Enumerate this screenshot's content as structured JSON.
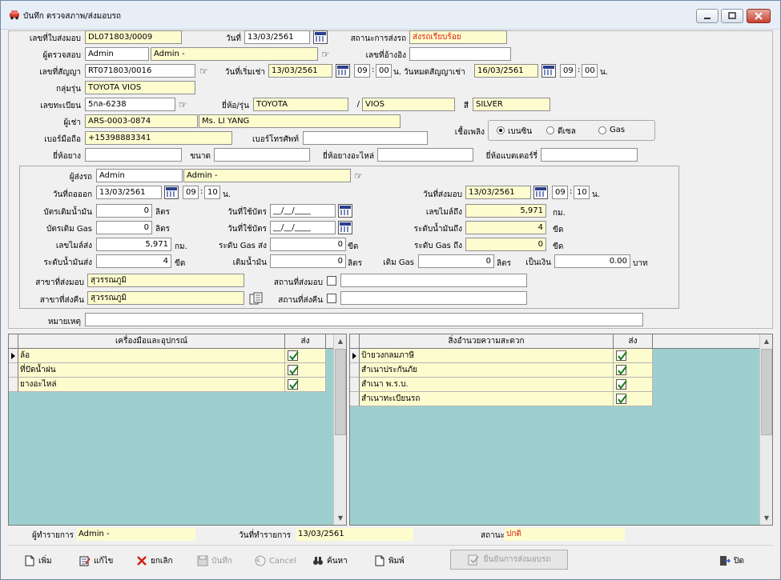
{
  "window": {
    "title": "บันทึก ตรวจสภาพ/ส่งมอบรถ"
  },
  "header": {
    "doc_no_label": "เลขที่ใบส่งมอบ",
    "doc_no": "DL071803/0009",
    "date_label": "วันที่",
    "date": "13/03/2561",
    "car_status_label": "สถานะการส่งรถ",
    "car_status": "ส่งรถเรียบร้อย",
    "inspector_label": "ผู้ตรวจสอบ",
    "inspector_code": "Admin",
    "inspector_name": "Admin -",
    "ref_no_label": "เลขที่อ้างอิง",
    "ref_no": "",
    "contract_label": "เลขที่สัญญา",
    "contract_no": "RT071803/0016",
    "rent_start_label": "วันที่เริ่มเช่า",
    "rent_start": "13/03/2561",
    "rent_start_h": "09",
    "rent_start_m": "00",
    "n1": "น.",
    "rent_end_label": "วันหมดสัญญาเช่า",
    "rent_end": "16/03/2561",
    "rent_end_h": "09",
    "rent_end_m": "00",
    "n2": "น.",
    "model_group_label": "กลุ่มรุ่น",
    "model_group": "TOYOTA VIOS",
    "plate_label": "เลขทะเบียน",
    "plate": "5กล-6238",
    "brand_label": "ยี่ห้อ/รุ่น",
    "brand": "TOYOTA",
    "slash": "/",
    "model": "VIOS",
    "color_label": "สี",
    "color": "SILVER",
    "renter_label": "ผู้เช่า",
    "renter_code": "ARS-0003-0874",
    "renter_name": "Ms. LI YANG",
    "mobile_label": "เบอร์มือถือ",
    "mobile": "+15398883341",
    "phone_label": "เบอร์โทรศัพท์",
    "phone": "",
    "fuel_label": "เชื้อเพลิง",
    "fuel_options": [
      "เบนซิน",
      "ดีเซล",
      "Gas"
    ],
    "tire_brand_label": "ยี่ห้อยาง",
    "tire_brand": "",
    "size_label": "ขนาด",
    "size": "",
    "spare_tire_label": "ยี่ห้อยางอะไหล่",
    "spare_tire": "",
    "battery_label": "ยี่ห้อแบตเตอร์รี่",
    "battery": ""
  },
  "delivery": {
    "driver_label": "ผู้ส่งรถ",
    "driver_code": "Admin",
    "driver_name": "Admin -",
    "out_date_label": "วันที่ถอออก",
    "out_date": "13/03/2561",
    "out_h": "09",
    "out_m": "10",
    "n3": "น.",
    "deliver_date_label": "วันที่ส่งมอบ",
    "deliver_date": "13/03/2561",
    "deliver_h": "09",
    "deliver_m": "10",
    "n4": "น.",
    "fuel_card_label": "บัตรเติมน้ำมัน",
    "fuel_card": "0",
    "liter1": "ลิตร",
    "card_date1_label": "วันที่ใช้บัตร",
    "card_date1": "__/__/____",
    "mile_to_label": "เลขไมล์ถึง",
    "mile_to": "5,971",
    "km1": "กม.",
    "gas_card_label": "บัตรเติม Gas",
    "gas_card": "0",
    "liter2": "ลิตร",
    "card_date2_label": "วันที่ใช้บัตร",
    "card_date2": "__/__/____",
    "fuel_level_to_label": "ระดับน้ำมันถึง",
    "fuel_level_to": "4",
    "bar1": "ขีด",
    "mile_send_label": "เลขไมล์ส่ง",
    "mile_send": "5,971",
    "km2": "กม.",
    "gas_level_send_label": "ระดับ Gas ส่ง",
    "gas_level_send": "0",
    "bar2": "ขีด",
    "gas_level_to_label": "ระดับ Gas ถึง",
    "gas_level_to": "0",
    "bar3": "ขีด",
    "fuel_level_send_label": "ระดับน้ำมันส่ง",
    "fuel_level_send": "4",
    "bar4": "ขีด",
    "add_fuel_label": "เติมน้ำมัน",
    "add_fuel": "0",
    "liter3": "ลิตร",
    "add_gas_label": "เติม Gas",
    "add_gas": "0",
    "liter4": "ลิตร",
    "amount_label": "เป็นเงิน",
    "amount": "0.00",
    "baht": "บาท",
    "branch_deliver_label": "สาขาที่ส่งมอบ",
    "branch_deliver": "สุวรรณภูมิ",
    "place_deliver_label": "สถานที่ส่งมอบ",
    "place_deliver": "",
    "branch_return_label": "สาขาที่ส่งคืน",
    "branch_return": "สุวรรณภูมิ",
    "place_return_label": "สถานที่ส่งคืน",
    "place_return": ""
  },
  "remark": {
    "label": "หมายเหตุ",
    "value": ""
  },
  "tools_grid": {
    "col_name": "เครื่องมือและอุปกรณ์",
    "col_send": "ส่ง",
    "rows": [
      "ล้อ",
      "ที่ปัดน้ำฝน",
      "ยางอะไหล่"
    ]
  },
  "amenities_grid": {
    "col_name": "สิ่งอำนวยความสะดวก",
    "col_send": "ส่ง",
    "rows": [
      "ป้ายวงกลมภาษี",
      "สำเนาประกันภัย",
      "สำเนา พ.ร.บ.",
      "สำเนาทะเบียนรถ"
    ]
  },
  "status": {
    "maker_label": "ผู้ทำรายการ",
    "maker": "Admin -",
    "make_date_label": "วันที่ทำรายการ",
    "make_date": "13/03/2561",
    "state_label": "สถานะ",
    "state": "ปกติ"
  },
  "toolbar": {
    "add": "เพิ่ม",
    "edit": "แก้ไข",
    "cancel_doc": "ยกเลิก",
    "save": "บันทึก",
    "cancel": "Cancel",
    "search": "ค้นหา",
    "print": "พิมพ์",
    "confirm": "ยืนยันการส่งมอบรถ",
    "close": "ปิด"
  }
}
